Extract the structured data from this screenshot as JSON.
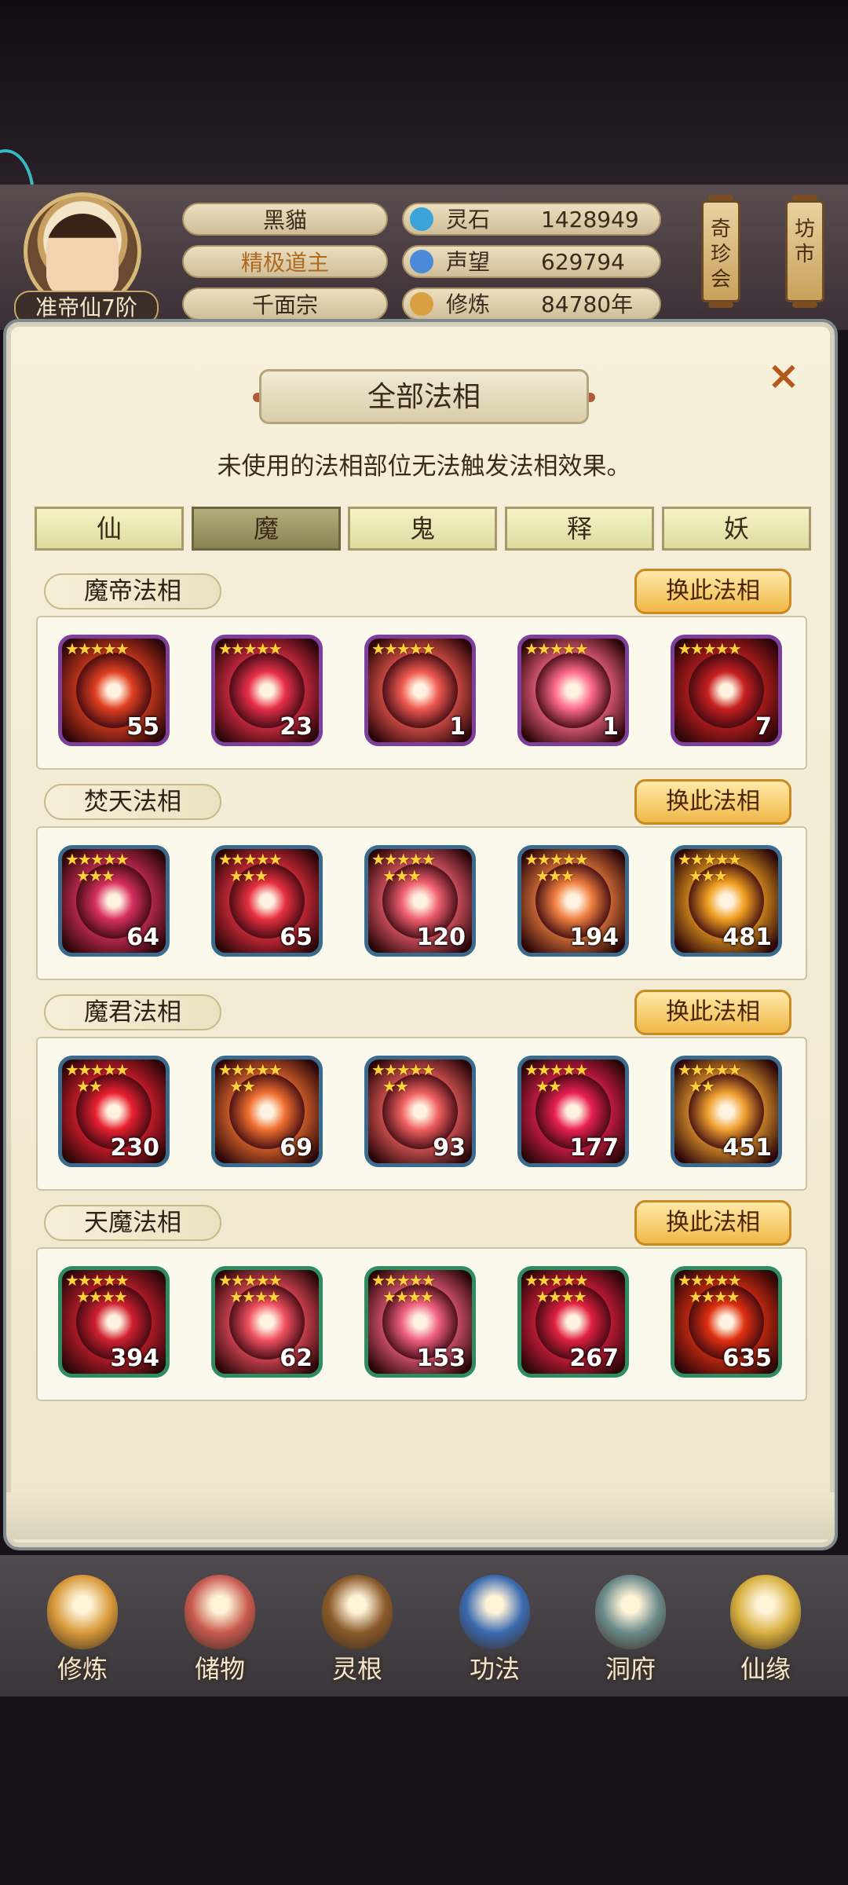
{
  "player": {
    "name": "黑貓",
    "title": "精极道主",
    "sect": "千面宗",
    "rank": "准帝仙7阶"
  },
  "resources": [
    {
      "label": "灵石",
      "value": "1428949",
      "icon": "spirit-stone-icon",
      "color": "#3aa4d8"
    },
    {
      "label": "声望",
      "value": "629794",
      "icon": "reputation-crystal-icon",
      "color": "#4a8ad8"
    },
    {
      "label": "修炼",
      "value": "84780年",
      "icon": "meditation-icon",
      "color": "#d8a040"
    }
  ],
  "side_buttons": {
    "treasure": "奇珍会",
    "market": "坊市"
  },
  "dialog": {
    "title": "全部法相",
    "close": "×",
    "subtitle": "未使用的法相部位无法触发法相效果。"
  },
  "tabs": [
    {
      "label": "仙",
      "active": false
    },
    {
      "label": "魔",
      "active": true
    },
    {
      "label": "鬼",
      "active": false
    },
    {
      "label": "释",
      "active": false
    },
    {
      "label": "妖",
      "active": false
    }
  ],
  "sections": [
    {
      "name": "魔帝法相",
      "button": "换此法相",
      "frame": "purple",
      "items": [
        {
          "stars": "★★★★★",
          "stars2": "",
          "value": "55",
          "color": "#e04020"
        },
        {
          "stars": "★★★★★",
          "stars2": "",
          "value": "23",
          "color": "#e8304a"
        },
        {
          "stars": "★★★★★",
          "stars2": "",
          "value": "1",
          "color": "#f05a50"
        },
        {
          "stars": "★★★★★",
          "stars2": "",
          "value": "1",
          "color": "#ff6a8a"
        },
        {
          "stars": "★★★★★",
          "stars2": "",
          "value": "7",
          "color": "#c82020"
        }
      ]
    },
    {
      "name": "焚天法相",
      "button": "换此法相",
      "frame": "blue",
      "items": [
        {
          "stars": "★★★★★",
          "stars2": "★★★",
          "value": "64",
          "color": "#d83060"
        },
        {
          "stars": "★★★★★",
          "stars2": "★★★",
          "value": "65",
          "color": "#e83040"
        },
        {
          "stars": "★★★★★",
          "stars2": "★★★",
          "value": "120",
          "color": "#f06070"
        },
        {
          "stars": "★★★★★",
          "stars2": "★★★",
          "value": "194",
          "color": "#f08040"
        },
        {
          "stars": "★★★★★",
          "stars2": "★★★",
          "value": "481",
          "color": "#f0a020"
        }
      ]
    },
    {
      "name": "魔君法相",
      "button": "换此法相",
      "frame": "blue",
      "items": [
        {
          "stars": "★★★★★",
          "stars2": "★★",
          "value": "230",
          "color": "#e82030"
        },
        {
          "stars": "★★★★★",
          "stars2": "★★",
          "value": "69",
          "color": "#f07030"
        },
        {
          "stars": "★★★★★",
          "stars2": "★★",
          "value": "93",
          "color": "#f06060"
        },
        {
          "stars": "★★★★★",
          "stars2": "★★",
          "value": "177",
          "color": "#e82050"
        },
        {
          "stars": "★★★★★",
          "stars2": "★★",
          "value": "451",
          "color": "#f0a030"
        }
      ]
    },
    {
      "name": "天魔法相",
      "button": "换此法相",
      "frame": "green",
      "items": [
        {
          "stars": "★★★★★",
          "stars2": "★★★★",
          "value": "394",
          "color": "#d02030"
        },
        {
          "stars": "★★★★★",
          "stars2": "★★★★",
          "value": "62",
          "color": "#f05060"
        },
        {
          "stars": "★★★★★",
          "stars2": "★★★★",
          "value": "153",
          "color": "#f06080"
        },
        {
          "stars": "★★★★★",
          "stars2": "★★★★",
          "value": "267",
          "color": "#e02040"
        },
        {
          "stars": "★★★★★",
          "stars2": "★★★★",
          "value": "635",
          "color": "#e03010"
        }
      ]
    }
  ],
  "nav": [
    {
      "label": "修炼",
      "icon": "cultivate-icon",
      "color": "#d89a3a"
    },
    {
      "label": "储物",
      "icon": "storage-bag-icon",
      "color": "#c85a50"
    },
    {
      "label": "灵根",
      "icon": "spirit-root-icon",
      "color": "#8a5a2a"
    },
    {
      "label": "功法",
      "icon": "technique-book-icon",
      "color": "#3a6ab0"
    },
    {
      "label": "洞府",
      "icon": "cave-house-icon",
      "color": "#6a8a8a"
    },
    {
      "label": "仙缘",
      "icon": "immortal-gourd-icon",
      "color": "#d8b040"
    }
  ]
}
